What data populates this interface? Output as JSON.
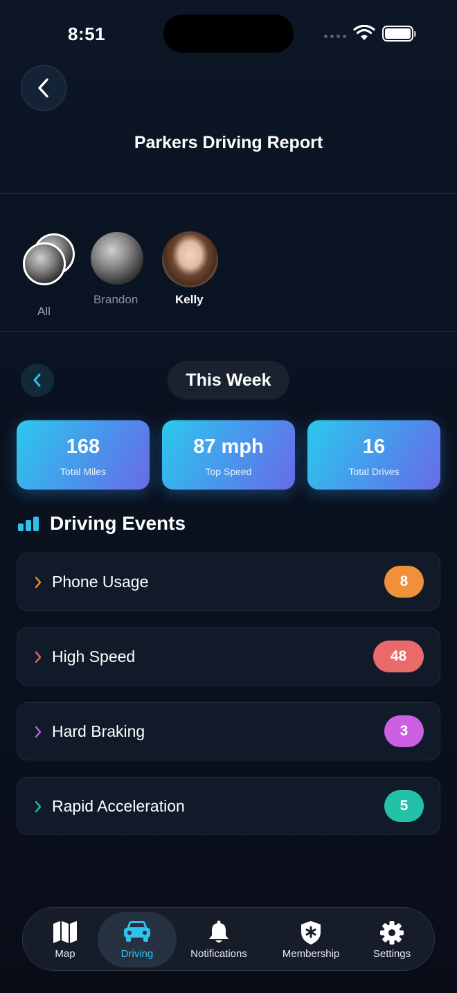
{
  "status_bar": {
    "time": "8:51"
  },
  "header": {
    "title": "Parkers Driving Report"
  },
  "profiles": [
    {
      "label": "All"
    },
    {
      "label": "Brandon"
    },
    {
      "label": "Kelly"
    }
  ],
  "period": {
    "label": "This Week"
  },
  "stats": [
    {
      "value": "168",
      "label": "Total Miles"
    },
    {
      "value": "87 mph",
      "label": "Top Speed"
    },
    {
      "value": "16",
      "label": "Total Drives"
    }
  ],
  "events_section": {
    "title": "Driving Events"
  },
  "events": [
    {
      "label": "Phone Usage",
      "count": "8",
      "color": "#f0903a"
    },
    {
      "label": "High Speed",
      "count": "48",
      "color": "#ea6a6c"
    },
    {
      "label": "Hard Braking",
      "count": "3",
      "color": "#cc5fe4"
    },
    {
      "label": "Rapid Acceleration",
      "count": "5",
      "color": "#22c1a8"
    }
  ],
  "nav": {
    "active": "Driving",
    "items": [
      {
        "label": "Map",
        "icon": "map-icon"
      },
      {
        "label": "Driving",
        "icon": "car-icon"
      },
      {
        "label": "Notifications",
        "icon": "bell-icon"
      },
      {
        "label": "Membership",
        "icon": "shield-icon"
      },
      {
        "label": "Settings",
        "icon": "gear-icon"
      }
    ]
  },
  "colors": {
    "accent": "#2fc2ea",
    "background": "#0a1220"
  }
}
